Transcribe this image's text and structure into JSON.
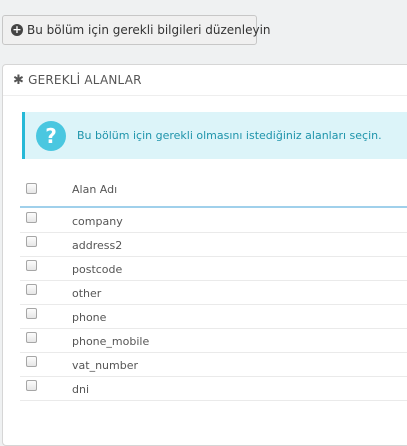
{
  "top_button": {
    "label": "Bu bölüm için gerekli bilgileri düzenleyin",
    "icon": "plus-circle-icon"
  },
  "panel": {
    "title": "GEREKLİ ALANLAR",
    "title_icon": "asterisk-icon",
    "alert": {
      "icon": "question-circle-icon",
      "text": "Bu bölüm için gerekli olmasını istediğiniz alanları seçin.",
      "accent_color": "#25b9d7"
    },
    "table": {
      "column_header": "Alan Adı",
      "rows": [
        {
          "name": "company",
          "checked": false
        },
        {
          "name": "address2",
          "checked": false
        },
        {
          "name": "postcode",
          "checked": false
        },
        {
          "name": "other",
          "checked": false
        },
        {
          "name": "phone",
          "checked": false
        },
        {
          "name": "phone_mobile",
          "checked": false
        },
        {
          "name": "vat_number",
          "checked": false
        },
        {
          "name": "dni",
          "checked": false
        }
      ]
    }
  }
}
